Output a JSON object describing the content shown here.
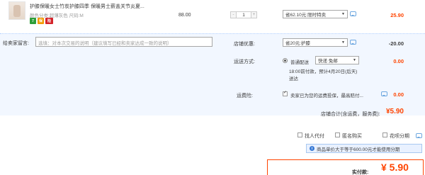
{
  "item": {
    "title": "护膝保暖女士竹炭护膝四季 保暖男士薪盖关节炎夏...",
    "sku": "颜色分类:超薄灰色  尺码:M",
    "badges": [
      "7",
      "保",
      "险"
    ],
    "price": "88.00",
    "quantity": "1",
    "minus": "-",
    "plus": "+",
    "promo": "省62.10元:限时特卖",
    "subtotal": "25.90"
  },
  "message": {
    "label": "给卖家留言:",
    "placeholder": "选填：对本次交易的说明（建议填写已经和卖家达成一致的说明）"
  },
  "shop_discount": {
    "label": "店铺优惠:",
    "selected": "省20元:护膝",
    "amount": "-20.00"
  },
  "shipping": {
    "label": "运送方式:",
    "type": "普通配送",
    "selected": "快递 免邮",
    "time": "18:00前付款，预计4月20日(后天)送达",
    "amount": "0.00"
  },
  "insurance": {
    "label": "运费险:",
    "text": "卖家已为您的运费投保，最高赔付...",
    "amount": "0.00"
  },
  "shop_total": {
    "label": "店铺合计(含运费，服务费):",
    "value": "¥5.90"
  },
  "options": {
    "proxy_pay": "找人代付",
    "anonymous": "匿名购买",
    "huabei": "花呗分期"
  },
  "notice": {
    "text": "商品单价大于等于600.00元才能使用分期"
  },
  "payment": {
    "label": "实付款:",
    "value": "¥ 5.90"
  },
  "colors": {
    "accent": "#ff4400",
    "info": "#3a7bd5",
    "highlight_bg": "#f2f7ff"
  }
}
